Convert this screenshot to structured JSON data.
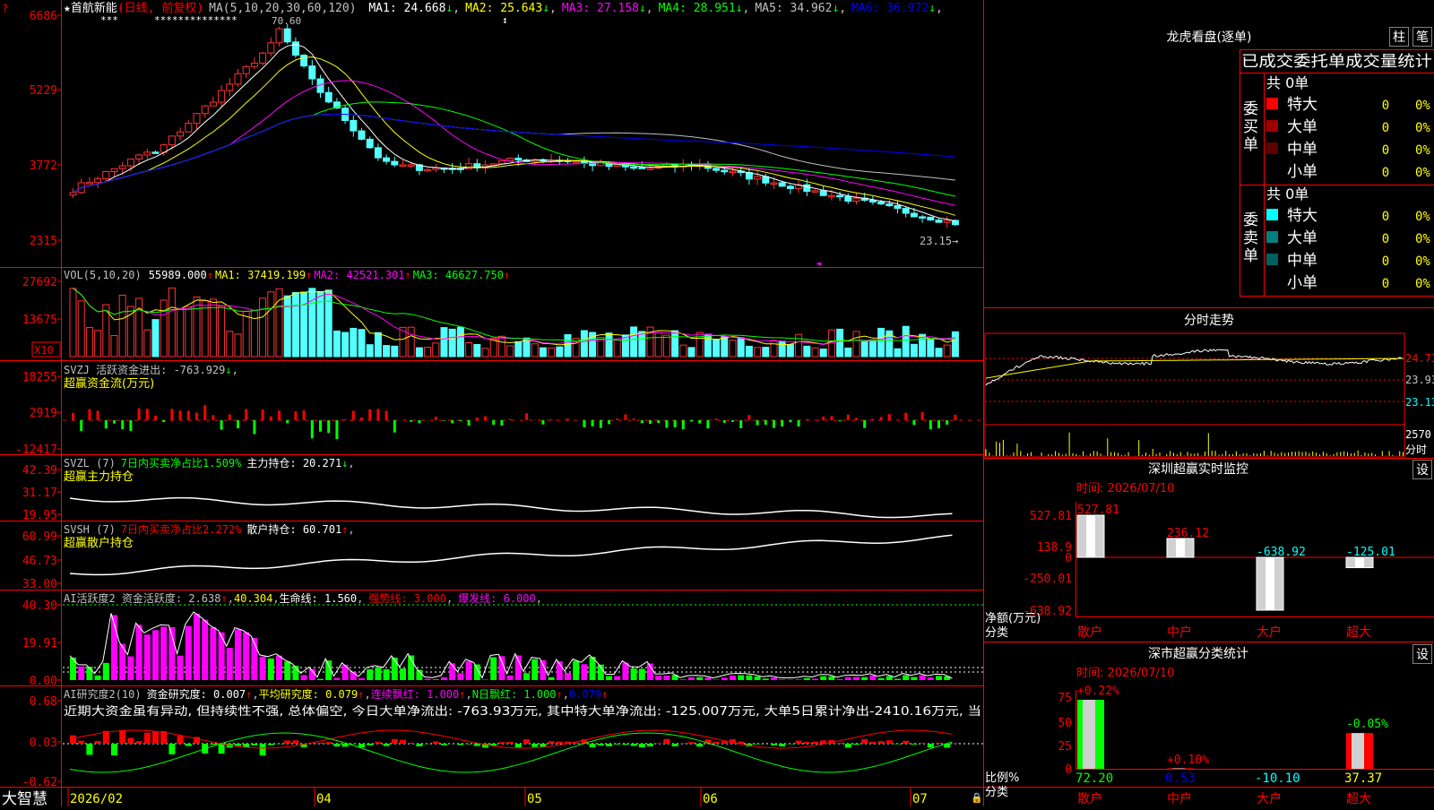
{
  "main_chart": {
    "stock_name": "首航新能",
    "stock_mark": "★",
    "adjust_label": "(日线, 前复权)",
    "ma_header": "MA(5,10,20,30,60,120)",
    "ma_values": [
      {
        "label": "MA1:",
        "value": "24.668",
        "arrow": "↓",
        "color": "#ffffff"
      },
      {
        "label": "MA2:",
        "value": "25.643",
        "arrow": "↓",
        "color": "#ffff00"
      },
      {
        "label": "MA3:",
        "value": "27.158",
        "arrow": "↓",
        "color": "#ff00ff"
      },
      {
        "label": "MA4:",
        "value": "28.951",
        "arrow": "↓",
        "color": "#00ff00"
      },
      {
        "label": "MA5:",
        "value": "34.962",
        "arrow": "↓",
        "color": "#c0c0c0"
      },
      {
        "label": "MA6:",
        "value": "36.972",
        "arrow": "↓",
        "color": "#0000ff"
      }
    ],
    "peak_label": "70.60",
    "last_price_label": "23.15→",
    "stars_1": "***",
    "stars_2": "**************",
    "y_ticks": [
      "6686",
      "5229",
      "3772",
      "2315"
    ],
    "colors": {
      "up": "#ff3232",
      "down": "#54ffff",
      "axis": "#ff0000"
    }
  },
  "vol_panel": {
    "header": "VOL(5,10,20)",
    "vol_value": "55989.000",
    "ma1": "MA1: 37419.199",
    "ma2": "MA2: 42521.301",
    "ma3": "MA3: 46627.750",
    "arrow": "↑",
    "y_ticks": [
      "27692",
      "13675"
    ],
    "unit": "X10"
  },
  "svzj_panel": {
    "header": "SVZJ  活跃资金进出: -763.929",
    "arrow": "↓",
    "subtitle": "超赢资金流(万元)",
    "y_ticks": [
      "18255",
      "2919",
      "-12417"
    ]
  },
  "svzl_panel": {
    "header": "SVZL (7)",
    "ratio": "7日内买卖净占比1.509%",
    "hold": "主力持仓: 20.271",
    "arrow": "↓",
    "subtitle": "超赢主力持仓",
    "y_ticks": [
      "42.39",
      "31.17",
      "19.95"
    ]
  },
  "svsh_panel": {
    "header": "SVSH (7)",
    "ratio": "7日内买卖净占比2.272%",
    "hold": "散户持仓: 60.701",
    "arrow": "↑",
    "subtitle": "超赢散户持仓",
    "y_ticks": [
      "60.99",
      "46.73",
      "33.00"
    ]
  },
  "ai_active_panel": {
    "header": "AI活跃度2 资金活跃度: 2.638",
    "v2": "40.304",
    "life": "生命线: 1.560",
    "strong": "强势线: 3.000",
    "burst": "爆发线: 6.000",
    "y_ticks": [
      "40.30",
      "19.91",
      "0.00"
    ]
  },
  "ai_research_panel": {
    "header": "AI研究度2(10)",
    "research": "资金研究度: 0.007",
    "avg": "平均研究度: 0.079",
    "red": "连续飘红: 1.000",
    "nred": "N日飘红: 1.000",
    "last": "0.079",
    "arrow": "↑",
    "comment": "近期大资金虽有异动, 但持续性不强, 总体偏空, 今日大单净流出: -763.93万元, 其中特大单净流出: -125.007万元, 大单5日累计净出-2410.16万元, 当",
    "y_ticks": [
      "0.68",
      "0.03",
      "-0.62"
    ]
  },
  "x_axis": {
    "app_name": "大智慧",
    "labels": [
      "2026/02",
      "04",
      "05",
      "06",
      "07"
    ]
  },
  "lhb": {
    "title": "龙虎看盘(逐单)",
    "btn_zhu": "柱",
    "btn_bi": "笔",
    "sub_header": "已成交委托单成交量统计",
    "buy_label": "委买单",
    "sell_label": "委卖单",
    "buy_total": "共 0单",
    "sell_total": "共 0单",
    "buy_rows": [
      {
        "name": "特大",
        "qty": "0",
        "pct": "0%",
        "color": "#ff0000"
      },
      {
        "name": "大单",
        "qty": "0",
        "pct": "0%",
        "color": "#a00000"
      },
      {
        "name": "中单",
        "qty": "0",
        "pct": "0%",
        "color": "#600000"
      },
      {
        "name": "小单",
        "qty": "0",
        "pct": "0%",
        "color": ""
      }
    ],
    "sell_rows": [
      {
        "name": "特大",
        "qty": "0",
        "pct": "0%",
        "color": "#00ffff"
      },
      {
        "name": "大单",
        "qty": "0",
        "pct": "0%",
        "color": "#008080"
      },
      {
        "name": "中单",
        "qty": "0",
        "pct": "0%",
        "color": "#006060"
      },
      {
        "name": "小单",
        "qty": "0",
        "pct": "0%",
        "color": ""
      }
    ]
  },
  "intraday": {
    "title": "分时走势",
    "y_labels": [
      "24.73",
      "23.93",
      "23.13"
    ],
    "vol_labels": [
      "2570",
      "分时"
    ]
  },
  "sz_monitor": {
    "title": "深圳超赢实时监控",
    "btn": "设",
    "time": "时间: 2026/07/10",
    "y_ticks": [
      "527.81",
      "138.9",
      "0",
      "-250.01",
      "-638.92"
    ],
    "unit_label": "净额(万元)",
    "cat_label": "分类",
    "categories": [
      "散户",
      "中户",
      "大户",
      "超大"
    ],
    "bar_labels": [
      "527.81",
      "236.12",
      "-638.92",
      "-125.01"
    ],
    "values": [
      527.81,
      236.12,
      -638.92,
      -125.01
    ]
  },
  "sz_stats": {
    "title": "深市超赢分类统计",
    "btn": "设",
    "time": "时间: 2026/07/10",
    "y_ticks": [
      "75",
      "50",
      "25",
      "0"
    ],
    "ratio_label": "比例%",
    "cat_label": "分类",
    "categories": [
      "散户",
      "中户",
      "大户",
      "超大"
    ],
    "values": [
      "72.20",
      "0.53",
      "-10.10",
      "37.37"
    ],
    "bar_labels": [
      "+0.22%",
      "+0.10%",
      "-0.05%"
    ],
    "bar_values": [
      72.2,
      0.53,
      -10.1,
      37.37
    ]
  }
}
